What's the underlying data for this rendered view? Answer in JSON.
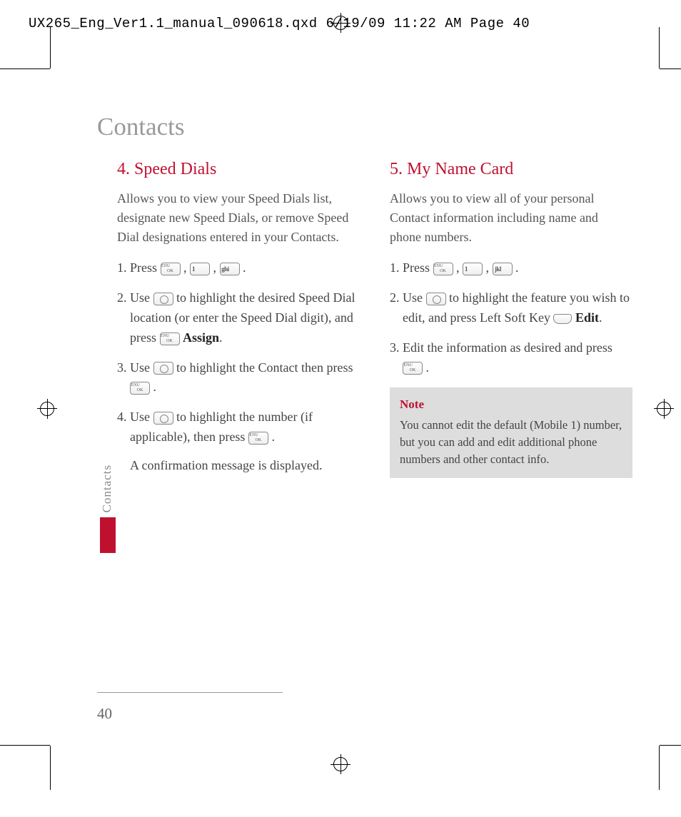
{
  "header": "UX265_Eng_Ver1.1_manual_090618.qxd  6/19/09  11:22 AM  Page 40",
  "title": "Contacts",
  "sideTab": "Contacts",
  "pageNumber": "40",
  "left": {
    "heading": "4. Speed Dials",
    "intro": "Allows you to view your Speed Dials list, designate new Speed Dials, or remove Speed Dial designations entered in your Contacts.",
    "steps": {
      "s1": {
        "pre": "1. Press ",
        "k1": "1",
        "k2": "4 ghi",
        "post": " ."
      },
      "s2": {
        "pre": "2. Use ",
        "mid": " to highlight the desired Speed Dial location (or enter the Speed Dial digit), and press ",
        "assign": " Assign",
        "end": "."
      },
      "s3": {
        "pre": "3. Use ",
        "mid": " to highlight the Contact then press ",
        "end": " ."
      },
      "s4": {
        "pre": "4. Use ",
        "mid": " to highlight the number (if applicable), then press ",
        "end": " .",
        "confirm": "A confirmation message is displayed."
      }
    }
  },
  "right": {
    "heading": "5. My Name Card",
    "intro": "Allows you to view all of your personal Contact information including name and phone numbers.",
    "steps": {
      "s1": {
        "pre": "1. Press ",
        "k1": "1",
        "k2": "5 jkl",
        "post": " ."
      },
      "s2": {
        "pre": "2. Use ",
        "mid": " to highlight the feature you wish to edit, and press Left Soft Key ",
        "edit": " Edit",
        "end": "."
      },
      "s3": {
        "pre": "3. Edit the information as desired and press ",
        "end": " ."
      }
    },
    "note": {
      "head": "Note",
      "body": "You cannot edit the default (Mobile 1) number, but you can add and edit additional phone numbers and other contact info."
    }
  }
}
